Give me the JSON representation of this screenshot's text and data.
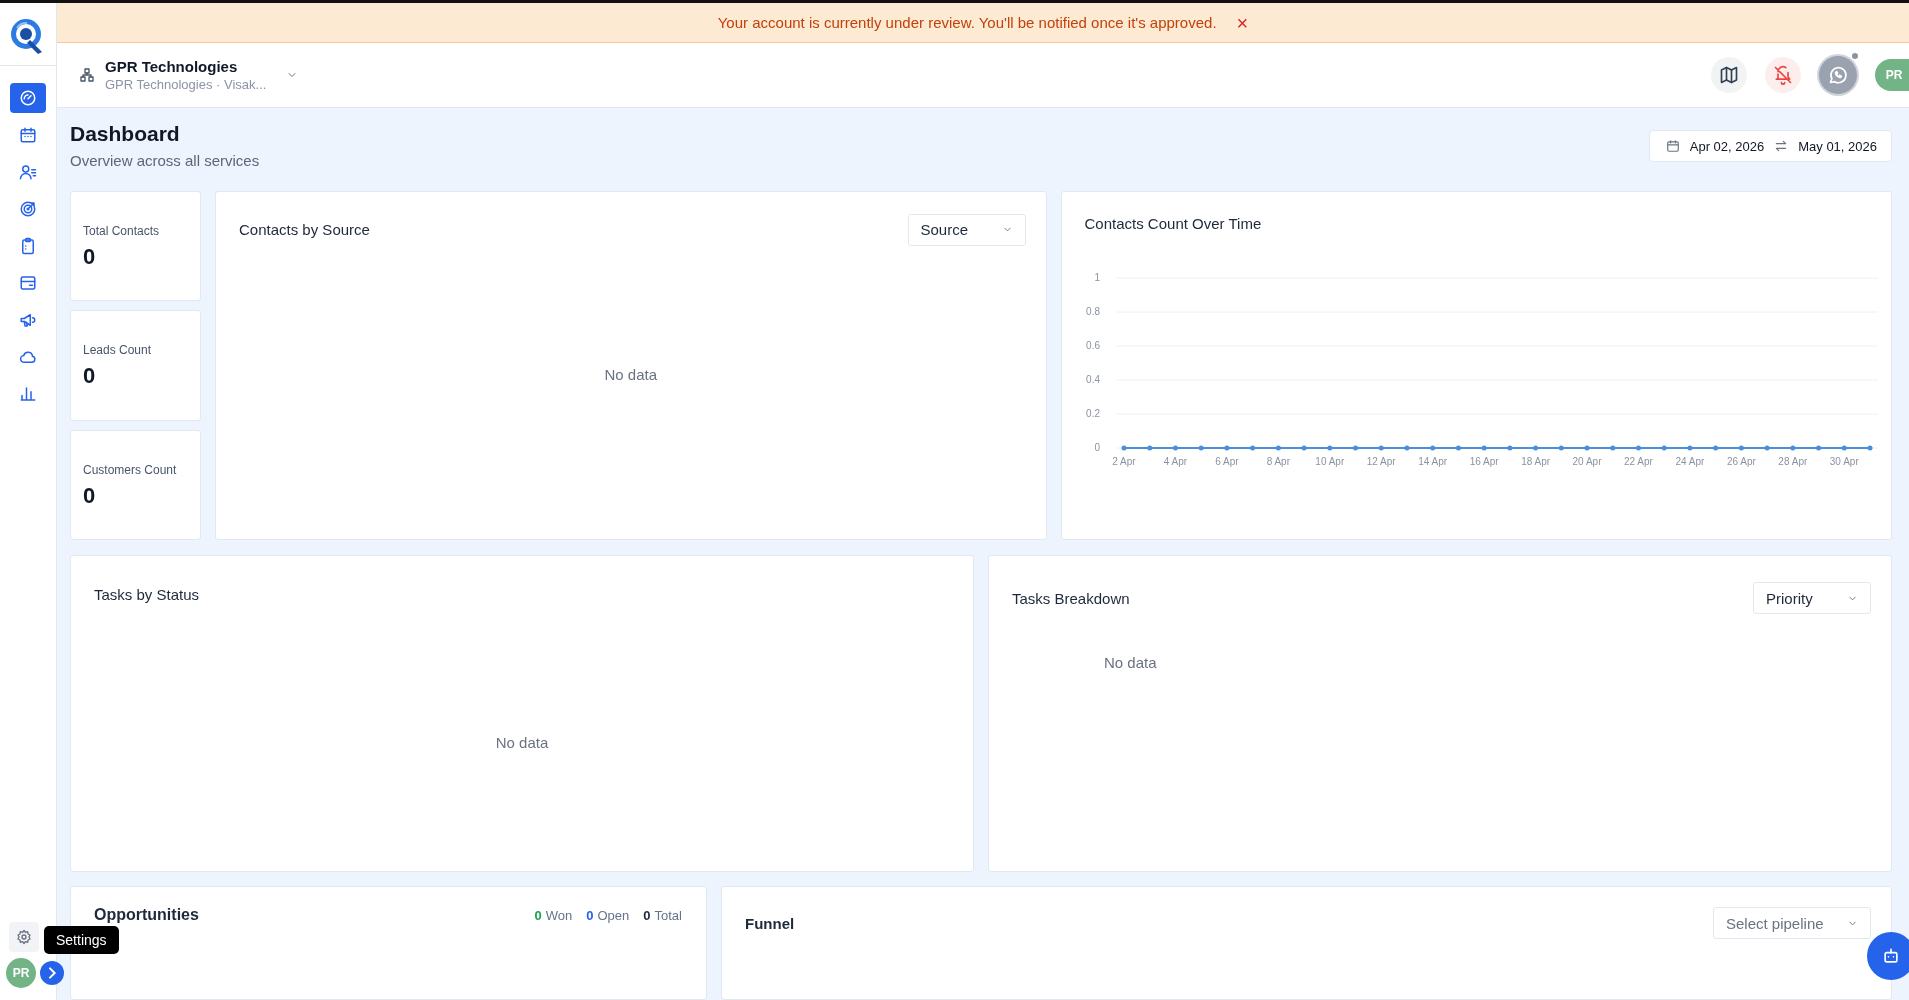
{
  "banner": {
    "message": "Your account is currently under review. You'll be notified once it's approved.",
    "close": "×"
  },
  "sidebar": {
    "items": [
      {
        "selected": true
      },
      {
        "selected": false
      },
      {
        "selected": false
      },
      {
        "selected": false
      },
      {
        "selected": false
      },
      {
        "selected": false
      },
      {
        "selected": false
      },
      {
        "selected": false
      },
      {
        "selected": false
      }
    ],
    "settings_tooltip": "Settings",
    "avatar": "PR"
  },
  "header": {
    "org_name": "GPR Technologies",
    "org_detail": "GPR Technologies · Visak...",
    "avatar": "PR",
    "whatsapp_status": true
  },
  "page": {
    "title": "Dashboard",
    "subtitle": "Overview across all services",
    "date_from": "Apr 02, 2026",
    "date_to": "May 01, 2026"
  },
  "stats": [
    {
      "label": "Total Contacts",
      "value": "0"
    },
    {
      "label": "Leads Count",
      "value": "0"
    },
    {
      "label": "Customers Count",
      "value": "0"
    }
  ],
  "contacts_by_source": {
    "title": "Contacts by Source",
    "filter": "Source",
    "empty": "No data"
  },
  "contacts_over_time": {
    "title": "Contacts Count Over Time",
    "chart_data": {
      "type": "line",
      "categories": [
        "2 Apr",
        null,
        "4 Apr",
        null,
        "6 Apr",
        null,
        "8 Apr",
        null,
        "10 Apr",
        null,
        "12 Apr",
        null,
        "14 Apr",
        null,
        "16 Apr",
        null,
        "18 Apr",
        null,
        "20 Apr",
        null,
        "22 Apr",
        null,
        "24 Apr",
        null,
        "26 Apr",
        null,
        "28 Apr",
        null,
        "30 Apr",
        null
      ],
      "series": [
        {
          "color": "#4a90d9",
          "values": [
            0,
            0,
            0,
            0,
            0,
            0,
            0,
            0,
            0,
            0,
            0,
            0,
            0,
            0,
            0,
            0,
            0,
            0,
            0,
            0,
            0,
            0,
            0,
            0,
            0,
            0,
            0,
            0,
            0,
            0
          ]
        }
      ],
      "ylim": [
        0,
        1
      ],
      "yticks": [
        0,
        0.2,
        0.4,
        0.6,
        0.8,
        1
      ],
      "grid": true
    }
  },
  "tasks_by_status": {
    "title": "Tasks by Status",
    "empty": "No data"
  },
  "tasks_breakdown": {
    "title": "Tasks Breakdown",
    "filter": "Priority",
    "empty": "No data"
  },
  "opportunities": {
    "title": "Opportunities",
    "counts": [
      {
        "count": "0",
        "label": "Won",
        "color": "#16a34a"
      },
      {
        "count": "0",
        "label": "Open",
        "color": "#2563eb"
      },
      {
        "count": "0",
        "label": "Total",
        "color": "#1e293b"
      }
    ]
  },
  "funnel": {
    "title": "Funnel",
    "placeholder": "Select pipeline"
  }
}
